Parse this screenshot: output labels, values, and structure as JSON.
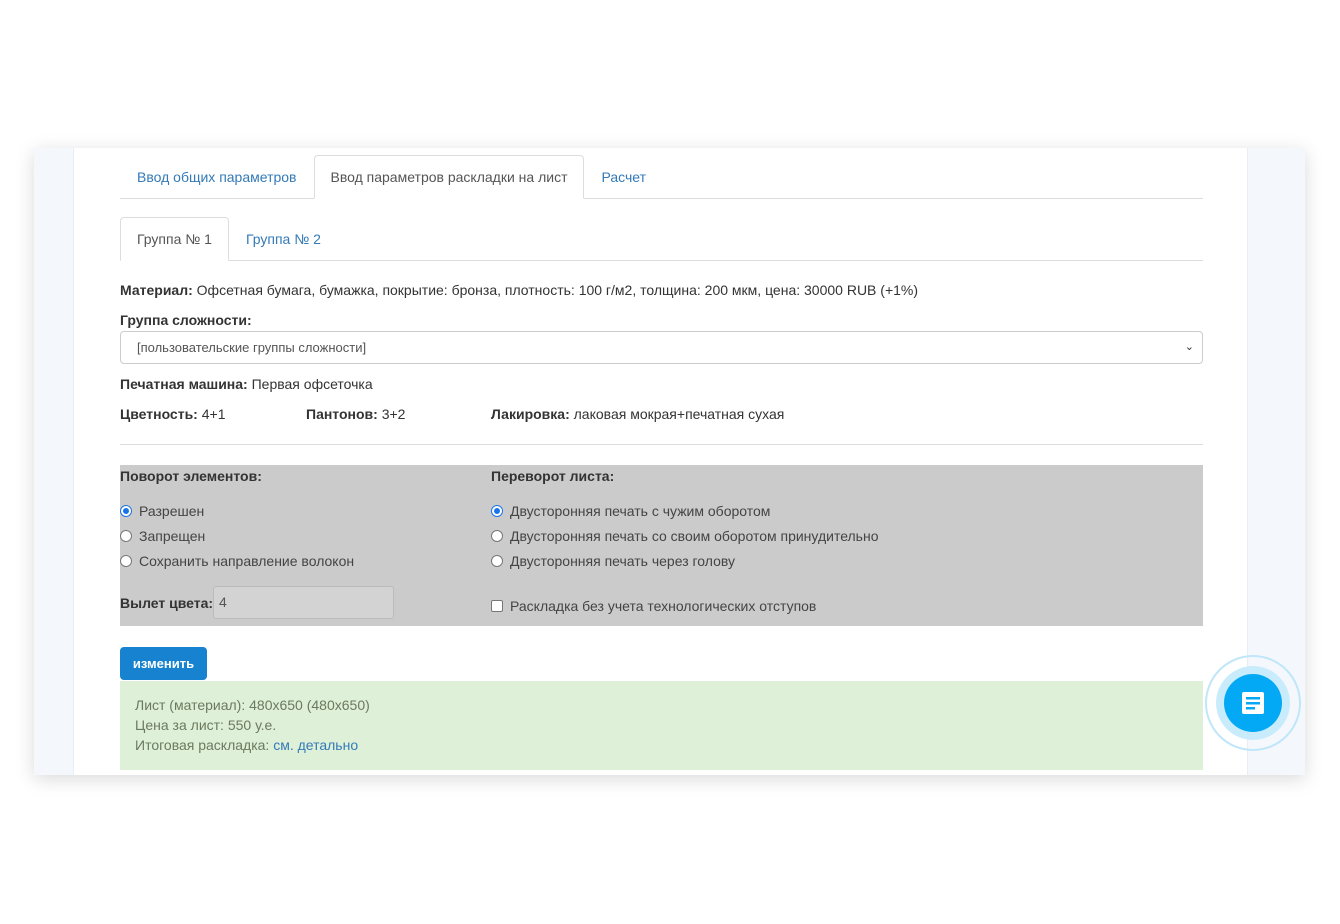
{
  "tabs": [
    "Ввод общих параметров",
    "Ввод параметров раскладки на лист",
    "Расчет"
  ],
  "subtabs": [
    "Группа № 1",
    "Группа № 2"
  ],
  "material": {
    "label": "Материал:",
    "value": " Офсетная бумага, бумажка, покрытие: бронза, плотность: 100 г/м2, толщина: 200 мкм, цена: 30000 RUB (+1%)"
  },
  "complexity": {
    "label": "Группа сложности:",
    "selected": "[пользовательские группы сложности]"
  },
  "press": {
    "label": "Печатная машина:",
    "value": " Первая офсеточка"
  },
  "colors": {
    "label": "Цветность:",
    "value": " 4+1"
  },
  "pantones": {
    "label": "Пантонов:",
    "value": " 3+2"
  },
  "varnish": {
    "label": "Лакировка:",
    "value": " лаковая мокрая+печатная сухая"
  },
  "rotation": {
    "label": "Поворот элементов:",
    "options": [
      "Разрешен",
      "Запрещен",
      "Сохранить направление волокон"
    ],
    "selected": 0
  },
  "flip": {
    "label": "Переворот листа:",
    "options": [
      "Двусторонняя печать с чужим оборотом",
      "Двусторонняя печать со своим оборотом принудительно",
      "Двусторонняя печать через голову"
    ],
    "selected": 0
  },
  "bleed": {
    "label": "Вылет цвета:",
    "value": "4"
  },
  "no_margins": {
    "label": "Раскладка без учета технологических отступов",
    "checked": false
  },
  "submit": "изменить",
  "result": {
    "sheet": "Лист (материал): 480x650 (480x650)",
    "price": "Цена за лист: 550 у.е.",
    "layout_label": "Итоговая раскладка: ",
    "layout_link": "см. детально"
  }
}
